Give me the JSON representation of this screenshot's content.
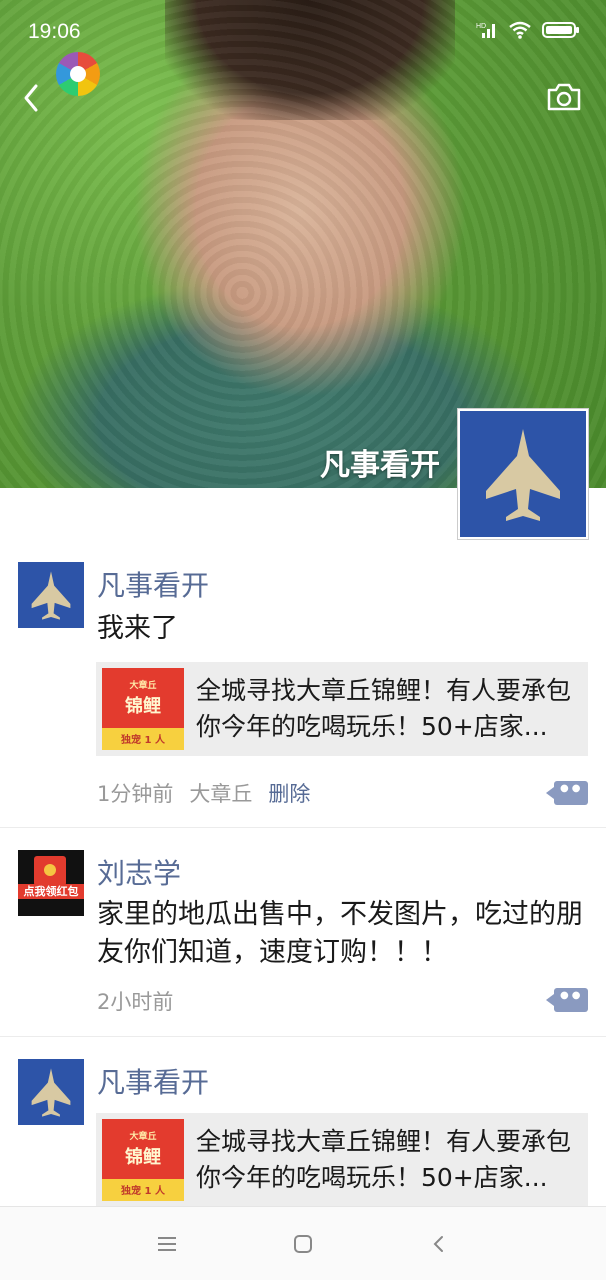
{
  "status_bar": {
    "time": "19:06",
    "network": "HD"
  },
  "profile": {
    "name": "凡事看开"
  },
  "posts": [
    {
      "author": "凡事看开",
      "text": "我来了",
      "link": {
        "title": "全城寻找大章丘锦鲤！有人要承包你今年的吃喝玩乐！50+店家...",
        "thumb_top": "大章丘",
        "thumb_main": "锦鲤",
        "thumb_bottom": "独宠 1 人"
      },
      "time": "1分钟前",
      "location": "大章丘",
      "delete_label": "删除"
    },
    {
      "author": "刘志学",
      "avatar_label": "点我领红包",
      "text": "家里的地瓜出售中，不发图片，吃过的朋友你们知道，速度订购！！！",
      "time": "2小时前"
    },
    {
      "author": "凡事看开",
      "link": {
        "title": "全城寻找大章丘锦鲤！有人要承包你今年的吃喝玩乐！50+店家...",
        "thumb_top": "大章丘",
        "thumb_main": "锦鲤",
        "thumb_bottom": "独宠 1 人"
      }
    }
  ],
  "icons": {
    "back": "chevron-left-icon",
    "camera": "camera-icon",
    "comment": "comment-icon",
    "menu": "menu-icon",
    "home": "home-square-icon",
    "nav_back": "nav-back-icon"
  }
}
